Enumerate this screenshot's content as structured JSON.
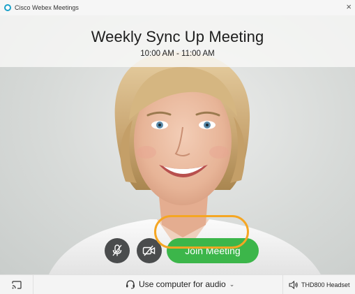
{
  "app": {
    "name": "Cisco Webex Meetings",
    "close_glyph": "×",
    "logo_icon": "webex-logo-icon"
  },
  "meeting": {
    "title": "Weekly Sync Up Meeting",
    "time": "10:00 AM - 11:00 AM"
  },
  "controls": {
    "mute_icon": "microphone-muted-icon",
    "video_icon": "video-off-icon",
    "join_label": "Join Meeting"
  },
  "bottom_bar": {
    "cast_icon": "screen-cast-icon",
    "audio_label": "Use computer for audio",
    "audio_icon": "headset-icon",
    "audio_chevron": "⌄",
    "speaker_icon": "speaker-icon",
    "speaker_label": "THD800 Headset"
  },
  "colors": {
    "join_green": "#3cb64a",
    "highlight_orange": "#f5a623",
    "control_gray": "#4a4c4d"
  }
}
